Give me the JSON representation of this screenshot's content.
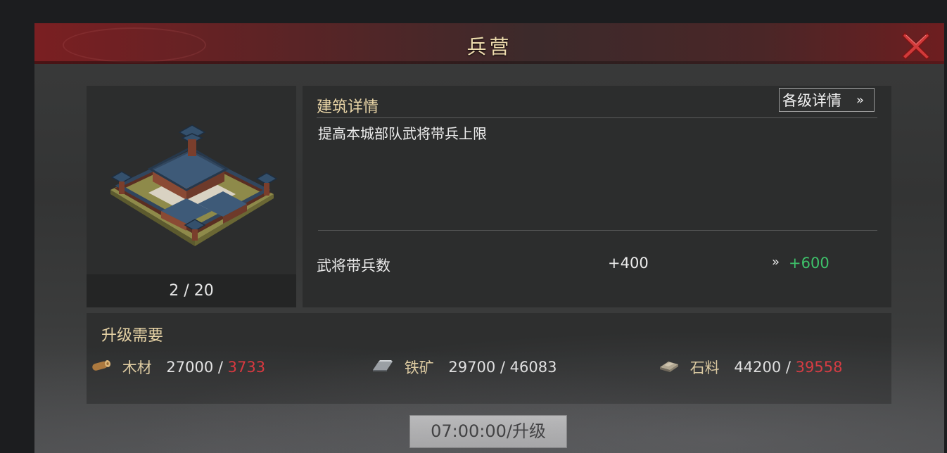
{
  "dialog": {
    "title": "兵营"
  },
  "building": {
    "level_text": "2 / 20"
  },
  "details": {
    "header": "建筑详情",
    "levels_button": "各级详情",
    "levels_button_icon": "double-chevron-right-icon",
    "description": "提高本城部队武将带兵上限",
    "stat": {
      "label": "武将带兵数",
      "current": "+400",
      "next": "+600"
    }
  },
  "requirements": {
    "title": "升级需要",
    "items": [
      {
        "icon": "wood-log-icon",
        "name": "木材",
        "required": "27000",
        "separator": " / ",
        "owned": "3733",
        "insufficient": true
      },
      {
        "icon": "iron-ingot-icon",
        "name": "铁矿",
        "required": "29700",
        "separator": " / ",
        "owned": "46083",
        "insufficient": false
      },
      {
        "icon": "stone-block-icon",
        "name": "石料",
        "required": "44200",
        "separator": " / ",
        "owned": "39558",
        "insufficient": true
      }
    ]
  },
  "upgrade_button": {
    "label": "07:00:00/升级"
  },
  "colors": {
    "title_text": "#efdcae",
    "accent_gold": "#e8d4a6",
    "positive_green": "#3ec26a",
    "insufficient_red": "#e0353c",
    "close_red": "#d23a3a"
  }
}
